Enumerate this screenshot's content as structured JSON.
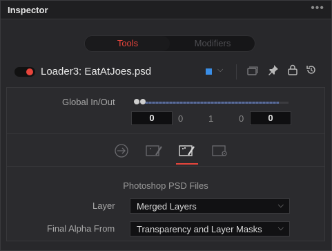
{
  "window": {
    "title": "Inspector",
    "menu_dots": "•••"
  },
  "tabs": {
    "tools": "Tools",
    "modifiers": "Modifiers"
  },
  "tool": {
    "name": "Loader3: EatAtJoes.psd",
    "enabled": true,
    "color_swatch": "#3a8ee6",
    "icons": [
      "chevron-down-icon",
      "version-icon",
      "pin-icon",
      "lock-icon",
      "reset-icon"
    ]
  },
  "global_io": {
    "label": "Global In/Out",
    "in_value": "0",
    "range_min": "0",
    "range_mid": "1",
    "range_max": "0",
    "out_value": "0"
  },
  "control_tabs": [
    "input-icon",
    "image-icon",
    "layer-icon",
    "settings-icon"
  ],
  "active_control_tab": 2,
  "psd": {
    "section_title": "Photoshop PSD Files",
    "layer_label": "Layer",
    "layer_value": "Merged Layers",
    "alpha_label": "Final Alpha From",
    "alpha_value": "Transparency and Layer Masks"
  },
  "colors": {
    "accent": "#e8453c",
    "swatch": "#3a8ee6"
  }
}
